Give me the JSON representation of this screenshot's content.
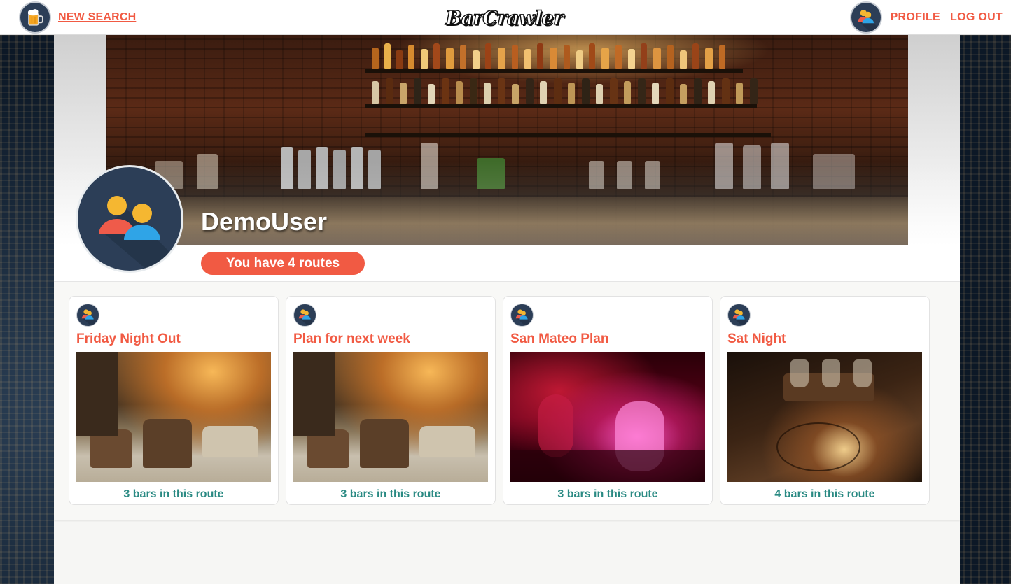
{
  "nav": {
    "new_search_label": "NEW SEARCH",
    "logo_text": "BarCrawler",
    "profile_label": "PROFILE",
    "logout_label": "LOG OUT"
  },
  "profile": {
    "username": "DemoUser",
    "routes_summary": "You have 4 routes"
  },
  "routes": [
    {
      "title": "Friday Night Out",
      "footer": "3 bars in this route",
      "photo": "lounge"
    },
    {
      "title": "Plan for next week",
      "footer": "3 bars in this route",
      "photo": "lounge"
    },
    {
      "title": "San Mateo Plan",
      "footer": "3 bars in this route",
      "photo": "club"
    },
    {
      "title": "Sat Night",
      "footer": "4 bars in this route",
      "photo": "bourbon"
    }
  ],
  "icons": {
    "beer": "beer-mug-icon",
    "users": "users-avatar-icon"
  },
  "colors": {
    "accent": "#f15a43",
    "teal": "#2a8a83",
    "avatar_bg": "#2c3e57"
  }
}
